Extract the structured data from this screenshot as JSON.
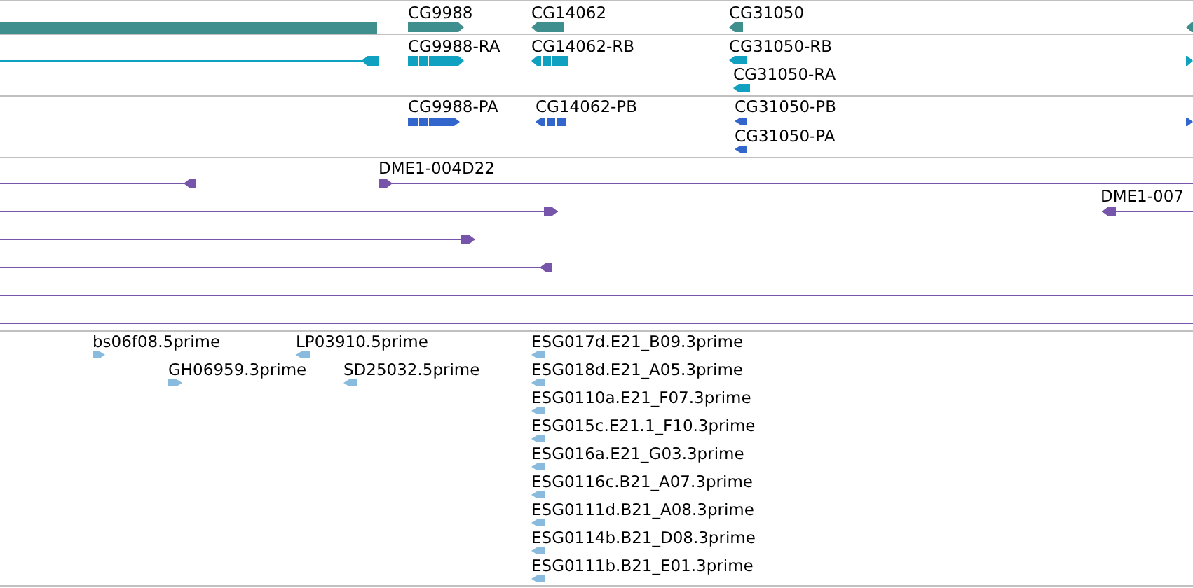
{
  "tracks": [
    {
      "kind": "gene",
      "features": [
        {
          "kind": "plain"
        },
        {
          "label": "CG9988",
          "kind": "forward"
        },
        {
          "label": "CG14062",
          "kind": "reverse"
        },
        {
          "label": "CG31050",
          "kind": "reverse"
        },
        {
          "kind": "reverse"
        }
      ]
    },
    {
      "kind": "transcript",
      "features": [
        {
          "kind": "reverse"
        },
        {
          "label": "CG9988-RA",
          "kind": "forward"
        },
        {
          "label": "CG14062-RB",
          "kind": "reverse"
        },
        {
          "label": "CG31050-RB",
          "kind": "reverse"
        },
        {
          "label": "CG31050-RA",
          "kind": "reverse"
        },
        {
          "kind": "forward"
        }
      ]
    },
    {
      "kind": "protein",
      "features": [
        {
          "label": "CG9988-PA",
          "kind": "forward"
        },
        {
          "label": "CG14062-PB",
          "kind": "reverse"
        },
        {
          "label": "CG31050-PB",
          "kind": "reverse"
        },
        {
          "label": "CG31050-PA",
          "kind": "reverse"
        },
        {
          "kind": "forward"
        }
      ]
    },
    {
      "kind": "clone",
      "features": [
        {
          "kind": "reverse"
        },
        {
          "label": "DME1-004D22",
          "kind": "forward"
        },
        {
          "kind": "forward"
        },
        {
          "label": "DME1-007",
          "kind": "reverse"
        },
        {
          "kind": "forward"
        },
        {
          "kind": "reverse"
        },
        {
          "kind": "plain"
        },
        {
          "kind": "plain"
        }
      ]
    },
    {
      "kind": "est",
      "features": [
        {
          "label": "bs06f08.5prime",
          "kind": "forward"
        },
        {
          "label": "GH06959.3prime",
          "kind": "forward"
        },
        {
          "label": "LP03910.5prime",
          "kind": "reverse"
        },
        {
          "label": "SD25032.5prime",
          "kind": "reverse"
        },
        {
          "label": "ESG017d.E21_B09.3prime",
          "kind": "reverse"
        },
        {
          "label": "ESG018d.E21_A05.3prime",
          "kind": "reverse"
        },
        {
          "label": "ESG0110a.E21_F07.3prime",
          "kind": "reverse"
        },
        {
          "label": "ESG015c.E21.1_F10.3prime",
          "kind": "reverse"
        },
        {
          "label": "ESG016a.E21_G03.3prime",
          "kind": "reverse"
        },
        {
          "label": "ESG0116c.B21_A07.3prime",
          "kind": "reverse"
        },
        {
          "label": "ESG0111d.B21_A08.3prime",
          "kind": "reverse"
        },
        {
          "label": "ESG0114b.B21_D08.3prime",
          "kind": "reverse"
        },
        {
          "label": "ESG0111b.B21_E01.3prime",
          "kind": "reverse"
        }
      ]
    }
  ]
}
